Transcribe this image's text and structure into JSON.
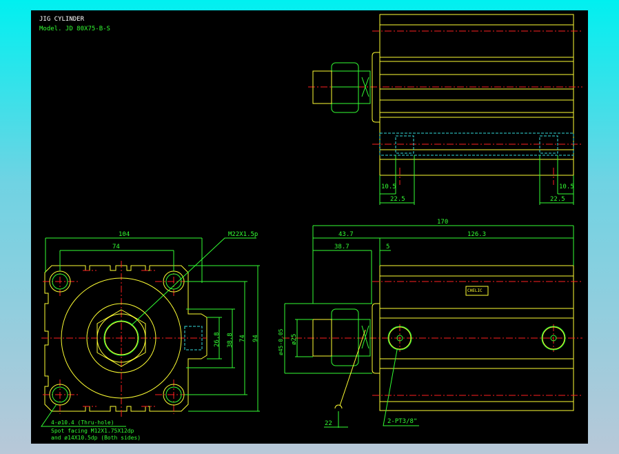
{
  "title": "JIG CYLINDER",
  "model": "Model. JD 80X75-B-S",
  "colors": {
    "background_top": "#00f0f0",
    "canvas": "#000000",
    "outline": "#ffff33",
    "dimension": "#33ff33",
    "centerline": "#ff2020",
    "hidden": "#33dddd"
  },
  "top_view": {
    "dims": [
      "10.5",
      "22.5",
      "10.5",
      "22.5"
    ]
  },
  "front_view": {
    "dims": {
      "overall": "170",
      "rod_side": "43.7",
      "body": "126.3",
      "rod_end": "38.7",
      "flange": "5",
      "bore": "ø45-0.05",
      "rod": "ø25"
    },
    "callouts": {
      "wrench": "22",
      "port": "2-PT3/8\""
    },
    "logo_text": "CHELIC"
  },
  "end_view": {
    "dims": {
      "width": "104",
      "pitch": "74",
      "d26": "26.8",
      "d38": "38.8",
      "vpitch": "74",
      "height": "94"
    },
    "thread_callout": "M22X1.5p",
    "note_lines": [
      "4-ø10.4 (Thru-hole)",
      "Spot facing M12X1.75X12dp",
      "and ø14X10.5dp (Both sides)"
    ]
  }
}
